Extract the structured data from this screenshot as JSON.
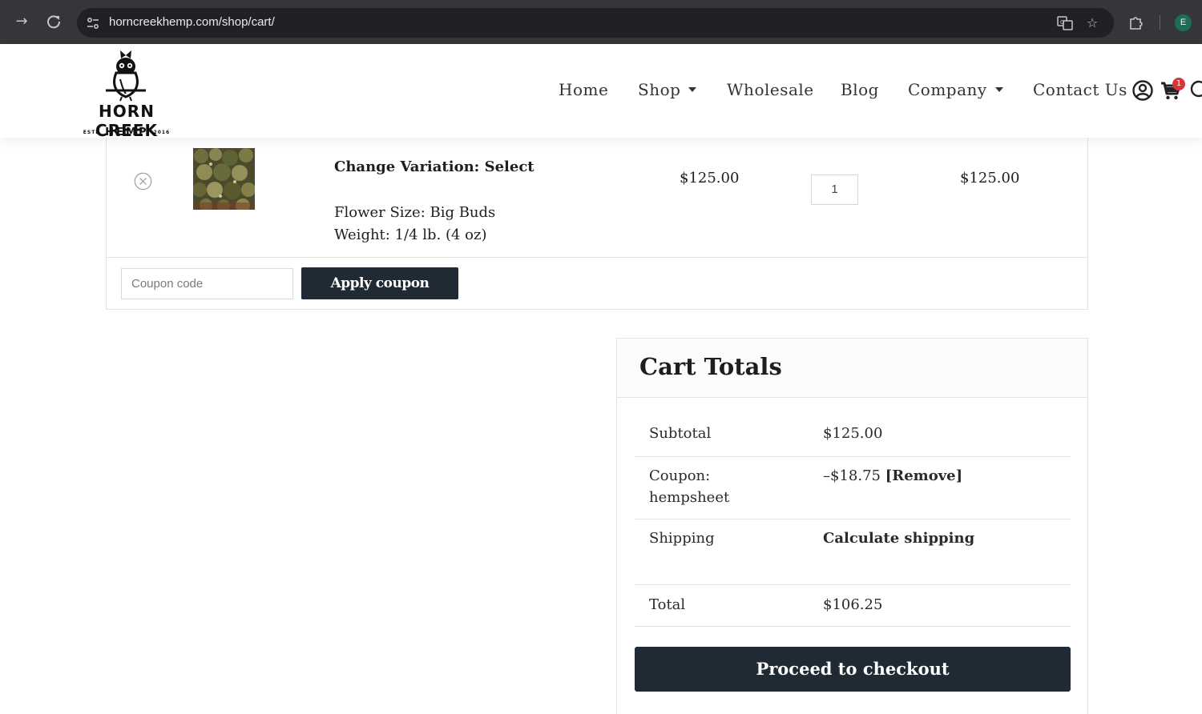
{
  "browser": {
    "url": "horncreekhemp.com/shop/cart/",
    "profile_initial": "E"
  },
  "brand": {
    "line1": "HORN CREEK",
    "line2": "HEMP",
    "estd": "ESTD",
    "year": "2016"
  },
  "nav": {
    "home": "Home",
    "shop": "Shop",
    "wholesale": "Wholesale",
    "blog": "Blog",
    "company": "Company",
    "contact": "Contact Us",
    "cart_count": "1"
  },
  "cart": {
    "item": {
      "title": "Change Variation: Select",
      "flower_size": "Flower Size: Big Buds",
      "weight": "Weight: 1/4 lb. (4 oz)",
      "price": "$125.00",
      "quantity": "1",
      "subtotal": "$125.00"
    },
    "coupon_placeholder": "Coupon code",
    "apply_label": "Apply coupon"
  },
  "totals": {
    "title": "Cart Totals",
    "subtotal_label": "Subtotal",
    "subtotal_value": "$125.00",
    "coupon_label_line1": "Coupon:",
    "coupon_label_line2": "hempsheet",
    "coupon_value": "–$18.75",
    "remove_label": "[Remove]",
    "shipping_label": "Shipping",
    "shipping_value": "Calculate shipping",
    "total_label": "Total",
    "total_value": "$106.25",
    "checkout_label": "Proceed to checkout"
  },
  "colors": {
    "chrome_bg": "#35363a",
    "button_dark": "#1f2a35",
    "badge_red": "#d63638"
  }
}
